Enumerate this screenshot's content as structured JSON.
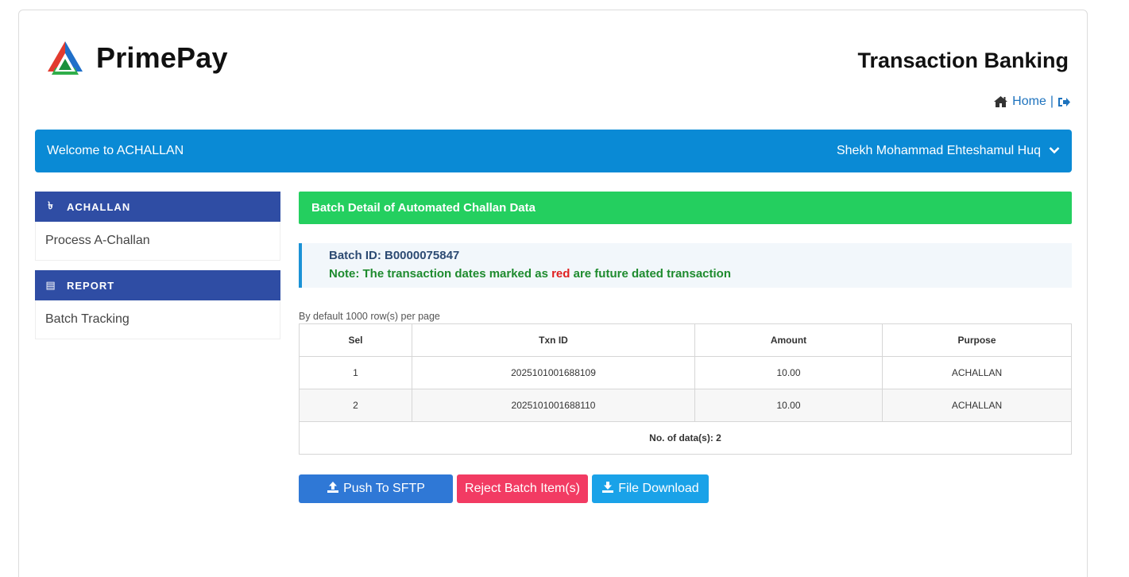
{
  "header": {
    "brand": "PrimePay",
    "app_title": "Transaction Banking",
    "home_label": "Home",
    "separator": "|"
  },
  "welcome_bar": {
    "text": "Welcome to ACHALLAN",
    "user_name": "Shekh Mohammad Ehteshamul Huq"
  },
  "sidebar": {
    "sections": [
      {
        "icon": "taka-icon",
        "icon_glyph": "৳",
        "title": "ACHALLAN",
        "items": [
          "Process A-Challan"
        ]
      },
      {
        "icon": "report-icon",
        "icon_glyph": "▤",
        "title": "REPORT",
        "items": [
          "Batch Tracking"
        ]
      }
    ]
  },
  "main": {
    "panel_title": "Batch Detail of Automated Challan Data",
    "batch_id": "Batch ID: B0000075847",
    "note_prefix": "Note: The transaction dates marked as",
    "note_red": "red",
    "note_suffix": "are future dated transaction",
    "per_page_text": "By default 1000 row(s) per page",
    "table": {
      "columns": [
        "Sel",
        "Txn ID",
        "Amount",
        "Purpose"
      ],
      "rows": [
        [
          "1",
          "2025101001688109",
          "10.00",
          "ACHALLAN"
        ],
        [
          "2",
          "2025101001688110",
          "10.00",
          "ACHALLAN"
        ]
      ],
      "footer": "No. of data(s): 2"
    },
    "buttons": {
      "push": "Push To SFTP",
      "reject": "Reject Batch Item(s)",
      "download": "File Download"
    }
  },
  "colors": {
    "welcome_bar": "#0a8ad5",
    "sidebar_header": "#2f4da4",
    "panel_header": "#24cf5f",
    "push_button": "#2f78d6",
    "reject_button": "#f23b63",
    "download_button": "#1aa2e8"
  }
}
